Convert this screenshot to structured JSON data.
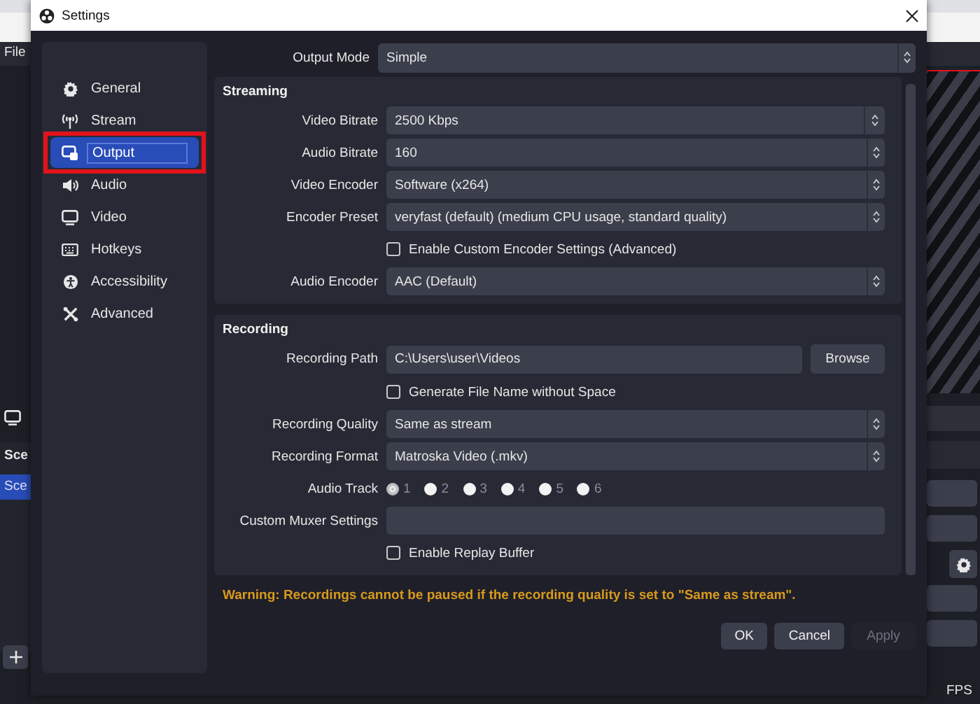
{
  "background": {
    "menu": "File",
    "scenes_header": "Sce",
    "scene_item": {
      "label": "Sce",
      "selected": true
    },
    "status": "FPS"
  },
  "dialog": {
    "title": "Settings"
  },
  "sidebar": [
    {
      "label": "General",
      "selected": false,
      "annotated": false
    },
    {
      "label": "Stream",
      "selected": false,
      "annotated": false
    },
    {
      "label": "Output",
      "selected": true,
      "annotated": true
    },
    {
      "label": "Audio",
      "selected": false,
      "annotated": false
    },
    {
      "label": "Video",
      "selected": false,
      "annotated": false
    },
    {
      "label": "Hotkeys",
      "selected": false,
      "annotated": false
    },
    {
      "label": "Accessibility",
      "selected": false,
      "annotated": false
    },
    {
      "label": "Advanced",
      "selected": false,
      "annotated": false
    }
  ],
  "output_mode": {
    "label": "Output Mode",
    "value": "Simple"
  },
  "sections": [
    {
      "title": "Streaming",
      "rows": [
        {
          "kind": "spin",
          "label": "Video Bitrate",
          "value": "2500 Kbps"
        },
        {
          "kind": "select",
          "label": "Audio Bitrate",
          "value": "160"
        },
        {
          "kind": "select",
          "label": "Video Encoder",
          "value": "Software (x264)"
        },
        {
          "kind": "select",
          "label": "Encoder Preset",
          "value": "veryfast (default) (medium CPU usage, standard quality)"
        },
        {
          "kind": "checkbox",
          "label": "Enable Custom Encoder Settings (Advanced)",
          "checked": false
        },
        {
          "kind": "select",
          "label": "Audio Encoder",
          "value": "AAC (Default)"
        }
      ]
    },
    {
      "title": "Recording",
      "rows": [
        {
          "kind": "path",
          "label": "Recording Path",
          "value": "C:\\Users\\user\\Videos",
          "button": "Browse"
        },
        {
          "kind": "checkbox",
          "label": "Generate File Name without Space",
          "checked": false
        },
        {
          "kind": "select",
          "label": "Recording Quality",
          "value": "Same as stream"
        },
        {
          "kind": "select",
          "label": "Recording Format",
          "value": "Matroska Video (.mkv)"
        },
        {
          "kind": "radio",
          "label": "Audio Track",
          "options": [
            {
              "label": "1",
              "selected": true
            },
            {
              "label": "2",
              "selected": false
            },
            {
              "label": "3",
              "selected": false
            },
            {
              "label": "4",
              "selected": false
            },
            {
              "label": "5",
              "selected": false
            },
            {
              "label": "6",
              "selected": false
            }
          ]
        },
        {
          "kind": "text",
          "label": "Custom Muxer Settings"
        },
        {
          "kind": "checkbox",
          "label": "Enable Replay Buffer",
          "checked": false
        }
      ]
    }
  ],
  "warning": "Warning: Recordings cannot be paused if the recording quality is set to \"Same as stream\".",
  "buttons": [
    {
      "label": "OK",
      "disabled": false
    },
    {
      "label": "Cancel",
      "disabled": false
    },
    {
      "label": "Apply",
      "disabled": true
    }
  ]
}
